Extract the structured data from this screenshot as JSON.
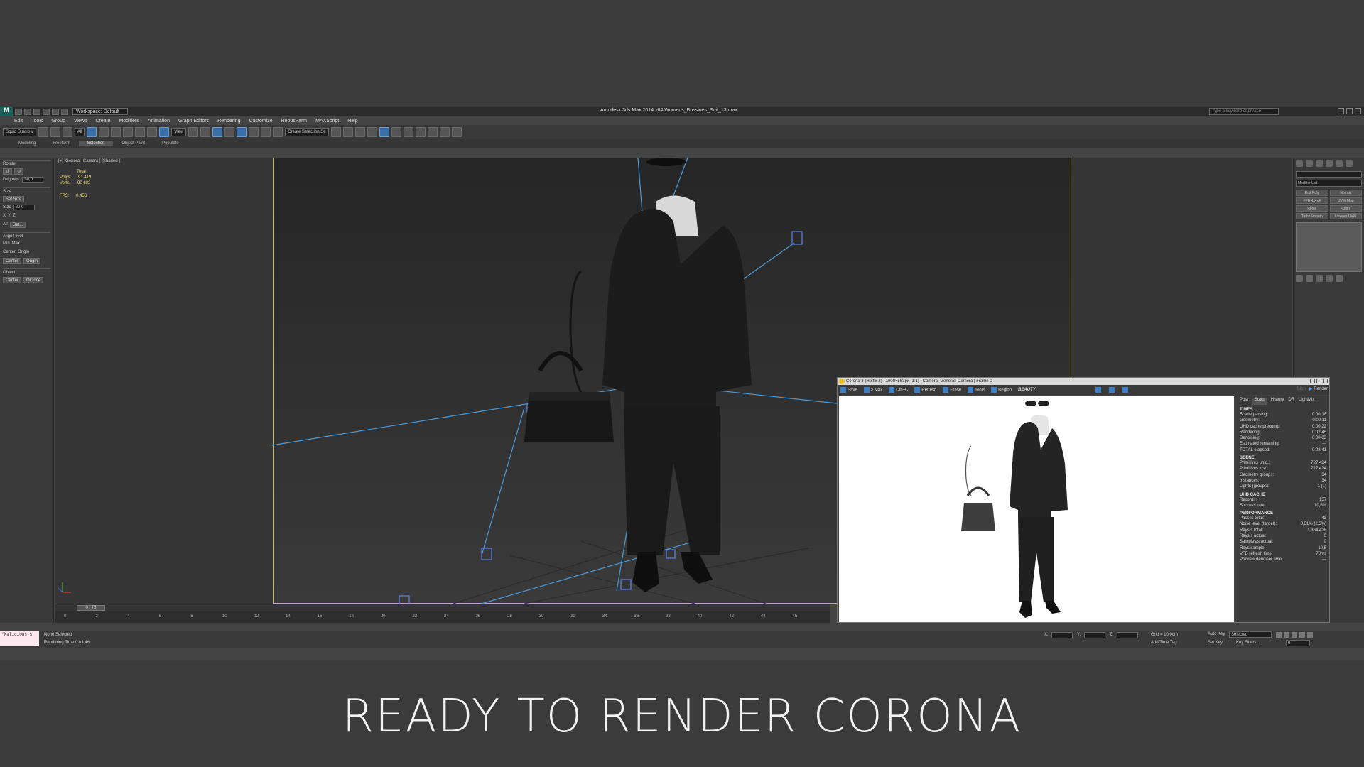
{
  "window": {
    "workspace": "Workspace: Default",
    "title": "Autodesk 3ds Max  2014 x64     Womens_Bussines_Suit_13.max",
    "search_placeholder": "Type a keyword or phrase"
  },
  "menu": [
    "Edit",
    "Tools",
    "Group",
    "Views",
    "Create",
    "Modifiers",
    "Animation",
    "Graph Editors",
    "Rendering",
    "Customize",
    "RebusFarm",
    "MAXScript",
    "Help"
  ],
  "toolbar": {
    "project": "Squid Studio v",
    "filter": "All",
    "view": "View",
    "selection_set": "Create Selection Se"
  },
  "ribbon_tabs": [
    {
      "label": "Modeling",
      "active": false
    },
    {
      "label": "Freeform",
      "active": false
    },
    {
      "label": "Selection",
      "active": true
    },
    {
      "label": "Object Paint",
      "active": false
    },
    {
      "label": "Populate",
      "active": false
    }
  ],
  "left_panel": {
    "rotate_title": "Rotate",
    "degrees_label": "Degrees:",
    "degrees_value": "90,0",
    "size_title": "Size",
    "set_size": "Set Size",
    "size_label": "Size",
    "size_value": "20,0",
    "axis_x": "X",
    "axis_y": "Y",
    "axis_z": "Z",
    "all_label": "All",
    "get_label": "Get...",
    "align_title": "Align Pivot",
    "min_label": "Min",
    "max_label": "Max",
    "center_label": "Center",
    "origin_label": "Origin",
    "center_btn": "Center",
    "origin_btn": "Origin",
    "object_title": "Object",
    "object_center": "Center",
    "qclone": "QClone"
  },
  "viewport": {
    "label": "[+] [General_Camera ] [Shaded ]",
    "stats_header": "Total",
    "polys_label": "Polys:",
    "polys_value": "91 419",
    "verts_label": "Verts:",
    "verts_value": "90 682",
    "fps_label": "FPS:",
    "fps_value": "0,458"
  },
  "vfb": {
    "title": "Corona 3 (Hotfix 2) | 1000×563px (1:1) | Camera: General_Camera | Frame 0",
    "toolbar": [
      "Save",
      "> Max",
      "Ctrl+C",
      "Refresh",
      "Erase",
      "Tools",
      "Region"
    ],
    "pass": "BEAUTY",
    "tabs": [
      "Post",
      "Stats",
      "History",
      "DR",
      "LightMix"
    ],
    "active_tab": "Stats",
    "stop_label": "Stop",
    "render_label": "Render",
    "sections": [
      {
        "title": "TIMES",
        "rows": [
          [
            "Scene parsing:",
            "0:00:18"
          ],
          [
            "Geometry:",
            "0:00:11"
          ],
          [
            "UHD cache precomp:",
            "0:00:22"
          ],
          [
            "Rendering:",
            "0:02:45"
          ],
          [
            "Denoising:",
            "0:00:03"
          ],
          [
            "Estimated remaining:",
            "---"
          ],
          [
            "TOTAL elapsed:",
            "0:03:41"
          ]
        ]
      },
      {
        "title": "SCENE",
        "rows": [
          [
            "Primitives uniq.:",
            "727 424"
          ],
          [
            "Primitives inst.:",
            "727 424"
          ],
          [
            "Geometry groups:",
            "34"
          ],
          [
            "Instances:",
            "34"
          ],
          [
            "Lights (groups):",
            "1 (1)"
          ]
        ]
      },
      {
        "title": "UHD CACHE",
        "rows": [
          [
            "Records:",
            "157"
          ],
          [
            "Success rate:",
            "10,6%"
          ]
        ]
      },
      {
        "title": "PERFORMANCE",
        "rows": [
          [
            "Passes total:",
            "43"
          ],
          [
            "Noise level (target):",
            "0,31% (2,5%)"
          ],
          [
            "Rays/s total:",
            "1 364 428"
          ],
          [
            "Rays/s actual:",
            "0"
          ],
          [
            "Samples/s actual:",
            "0"
          ],
          [
            "Rays/sample:",
            "10,5"
          ],
          [
            "VFB refresh time:",
            "78ms"
          ],
          [
            "Preview denoiser time:",
            "---"
          ]
        ]
      }
    ]
  },
  "right_panel": {
    "modifier_list": "Modifier List",
    "modifiers": [
      "Edit Poly",
      "Normal",
      "FFD 4x4x4",
      "UVW Map",
      "Relax",
      "Cloth",
      "TurboSmooth",
      "Unwrap UVW"
    ]
  },
  "timeline": {
    "frame_label": "0 / 73",
    "ticks": [
      "0",
      "2",
      "4",
      "6",
      "8",
      "10",
      "12",
      "14",
      "16",
      "18",
      "20",
      "22",
      "24",
      "26",
      "28",
      "30",
      "32",
      "34",
      "36",
      "38",
      "40",
      "42",
      "44",
      "46"
    ]
  },
  "status": {
    "maxscript": "\"Malicious s",
    "selection": "None Selected",
    "render_time": "Rendering Time  0:03:46",
    "x_label": "X:",
    "y_label": "Y:",
    "z_label": "Z:",
    "grid": "Grid = 10,0cm",
    "add_time_tag": "Add Time Tag",
    "auto_key": "Auto Key",
    "auto_key_value": "Selected",
    "set_key": "Set Key",
    "key_filters": "Key Filters...",
    "frame_value": "0"
  },
  "caption": "READY TO RENDER  CORONA"
}
